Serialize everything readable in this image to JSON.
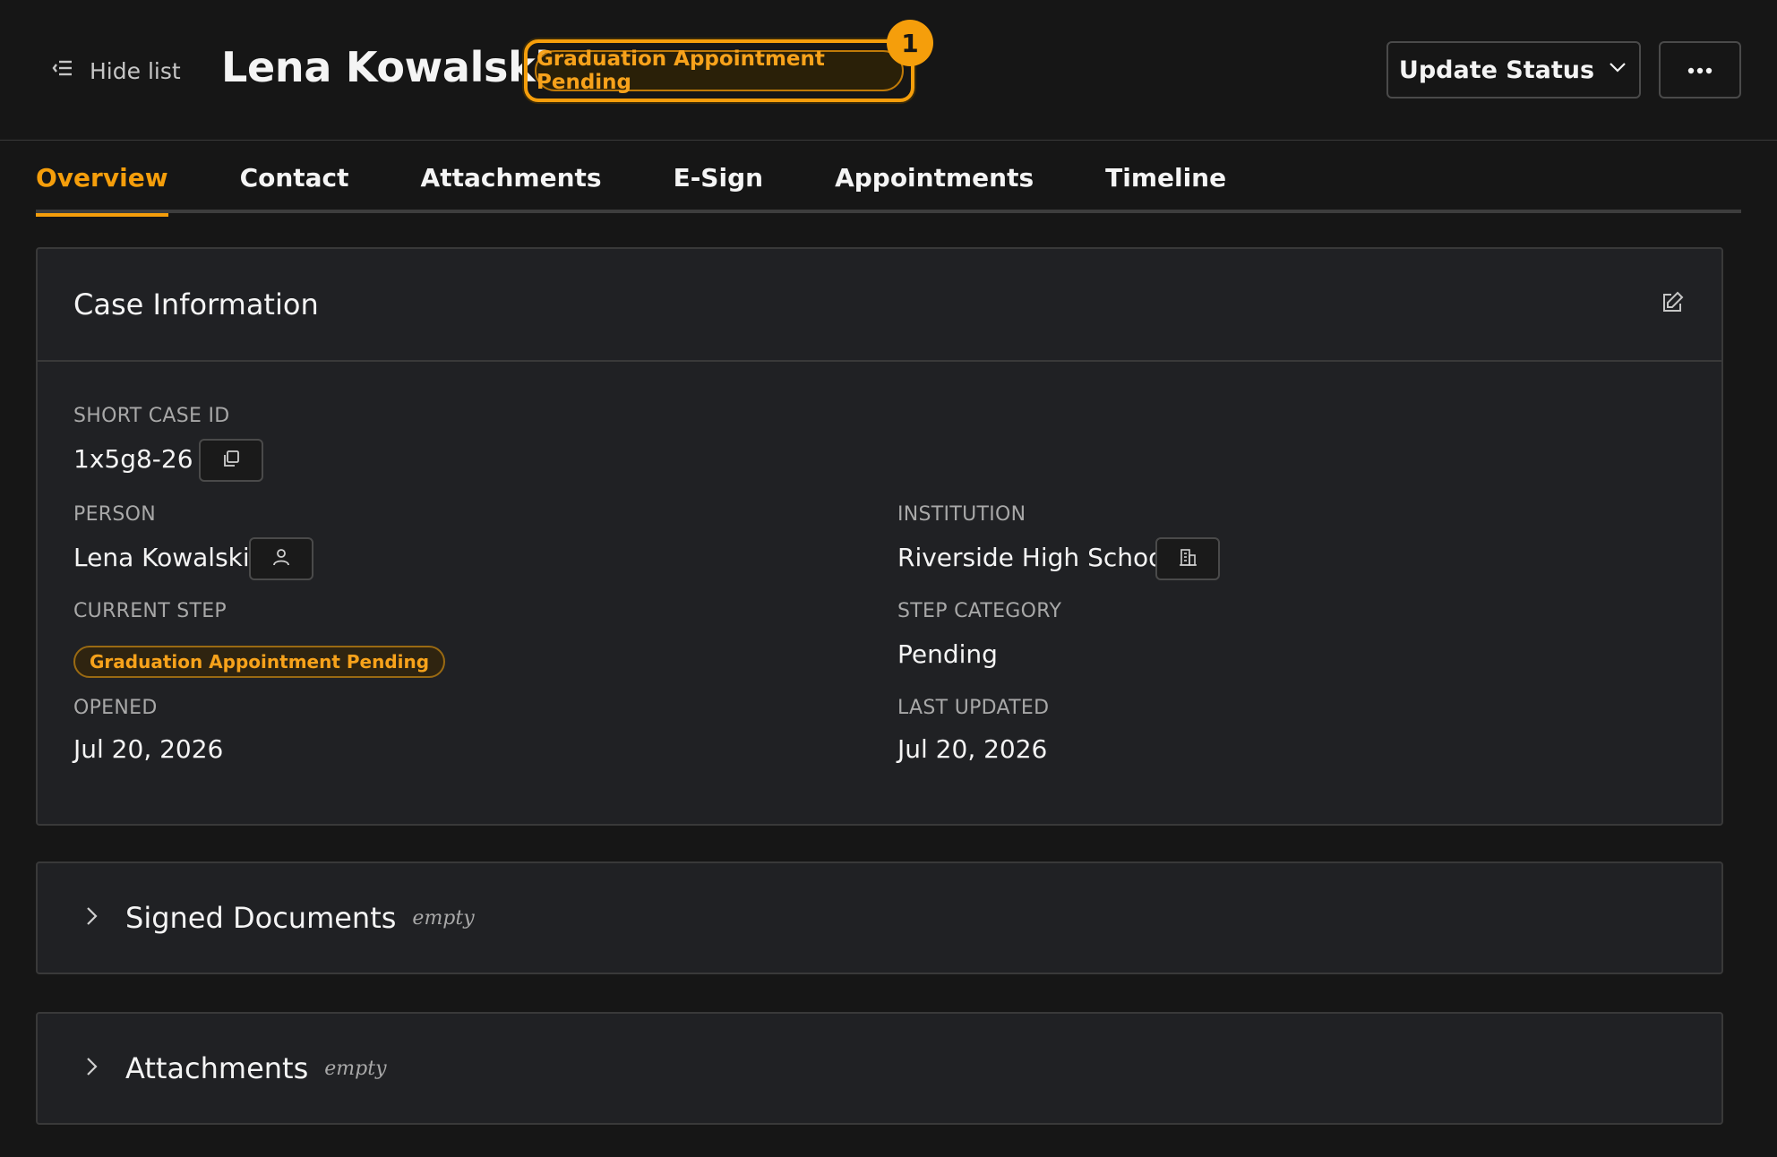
{
  "header": {
    "hide_list_label": "Hide list",
    "title": "Lena Kowalski",
    "status_label": "Graduation Appointment Pending",
    "notification_count": "1",
    "update_status_label": "Update Status"
  },
  "tabs": [
    {
      "label": "Overview",
      "active": true
    },
    {
      "label": "Contact",
      "active": false
    },
    {
      "label": "Attachments",
      "active": false
    },
    {
      "label": "E-Sign",
      "active": false
    },
    {
      "label": "Appointments",
      "active": false
    },
    {
      "label": "Timeline",
      "active": false
    }
  ],
  "case_info": {
    "title": "Case Information",
    "short_case_id_label": "SHORT CASE ID",
    "short_case_id": "1x5g8-26",
    "person_label": "PERSON",
    "person": "Lena Kowalski",
    "institution_label": "INSTITUTION",
    "institution": "Riverside High School",
    "current_step_label": "CURRENT STEP",
    "current_step": "Graduation Appointment Pending",
    "step_category_label": "STEP CATEGORY",
    "step_category": "Pending",
    "opened_label": "OPENED",
    "opened": "Jul 20, 2026",
    "last_updated_label": "LAST UPDATED",
    "last_updated": "Jul 20, 2026"
  },
  "sections": {
    "signed_documents": {
      "title": "Signed Documents",
      "state": "empty"
    },
    "attachments": {
      "title": "Attachments",
      "state": "empty"
    }
  },
  "colors": {
    "accent": "#f59e0b",
    "background": "#161616",
    "card": "#202124"
  }
}
